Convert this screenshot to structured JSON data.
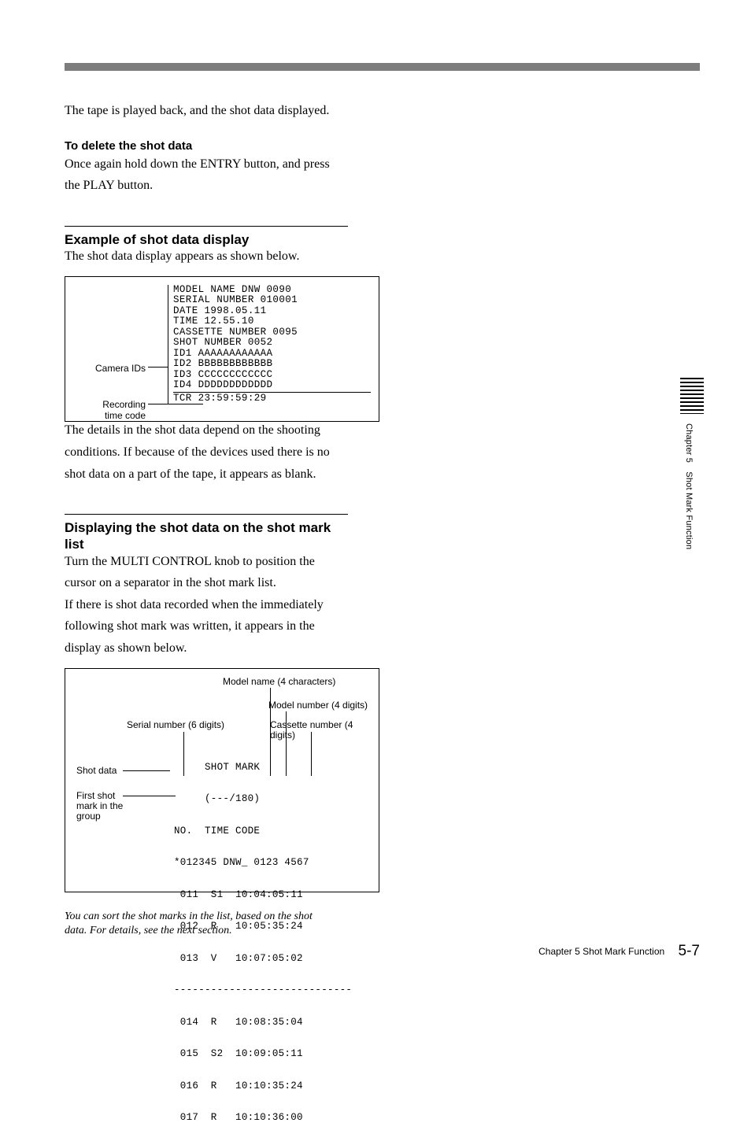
{
  "intro": "The tape is played back, and the shot data displayed.",
  "delete_heading": "To delete the shot data",
  "delete_text_1": "Once again hold down the ENTRY button, and press",
  "delete_text_2": "the PLAY button.",
  "example_heading": "Example of shot data display",
  "example_text": "The shot data display appears as shown below.",
  "display": {
    "model": "MODEL NAME   DNW 0090",
    "serial": "SERIAL NUMBER  010001",
    "date": "DATE       1998.05.11",
    "time": "TIME         12.55.10",
    "cassette": "CASSETTE NUMBER  0095",
    "shot": "SHOT NUMBER      0052",
    "id1": "ID1     AAAAAAAAAAAA",
    "id2": "ID2     BBBBBBBBBBBB",
    "id3": "ID3     CCCCCCCCCCCC",
    "id4": "ID4     DDDDDDDDDDDD",
    "tcr": "  TCR 23:59:59:29",
    "label_camera": "Camera IDs",
    "label_tcr1": "Recording",
    "label_tcr2": "time code"
  },
  "details_1": "The details in the shot data depend on the shooting",
  "details_2": "conditions. If because of the devices used there is no",
  "details_3": "shot data on a part of the tape, it appears as blank.",
  "list_heading": "Displaying the shot data on the shot mark list",
  "list_text_1": "Turn the MULTI CONTROL knob to position the",
  "list_text_2": "cursor on a separator in the shot mark list.",
  "list_text_3": "If there is shot data recorded when the immediately",
  "list_text_4": "following shot mark was written, it appears in the",
  "list_text_5": "display as shown below.",
  "listbox": {
    "lbl_modelname": "Model name (4 characters)",
    "lbl_modelnum": "Model number (4 digits)",
    "lbl_serial": "Serial number (6 digits)",
    "lbl_cassette": "Cassette number (4 digits)",
    "lbl_shotdata": "Shot data",
    "lbl_first1": "First shot",
    "lbl_first2": "mark in the",
    "lbl_first3": "group",
    "scr_l1": "     SHOT MARK",
    "scr_l2": "     (---/180)",
    "scr_l3": "NO.  TIME CODE",
    "scr_l4": "*012345 DNW_ 0123 4567",
    "scr_l5": " 011  S1  10:04:05:11",
    "scr_l6": " 012  R   10:05:35:24",
    "scr_l7": " 013  V   10:07:05:02",
    "scr_l8": "-----------------------------",
    "scr_l9": " 014  R   10:08:35:04",
    "scr_l10": " 015  S2  10:09:05:11",
    "scr_l11": " 016  R   10:10:35:24",
    "scr_l12": " 017  R   10:10:36:00"
  },
  "note_1": "You can sort the shot marks in the list, based on the shot",
  "note_2": "data. For details, see the next section.",
  "side_text": "Chapter 5 Shot Mark Function",
  "footer_chapter": "Chapter 5   Shot Mark Function",
  "footer_page": "5-7"
}
